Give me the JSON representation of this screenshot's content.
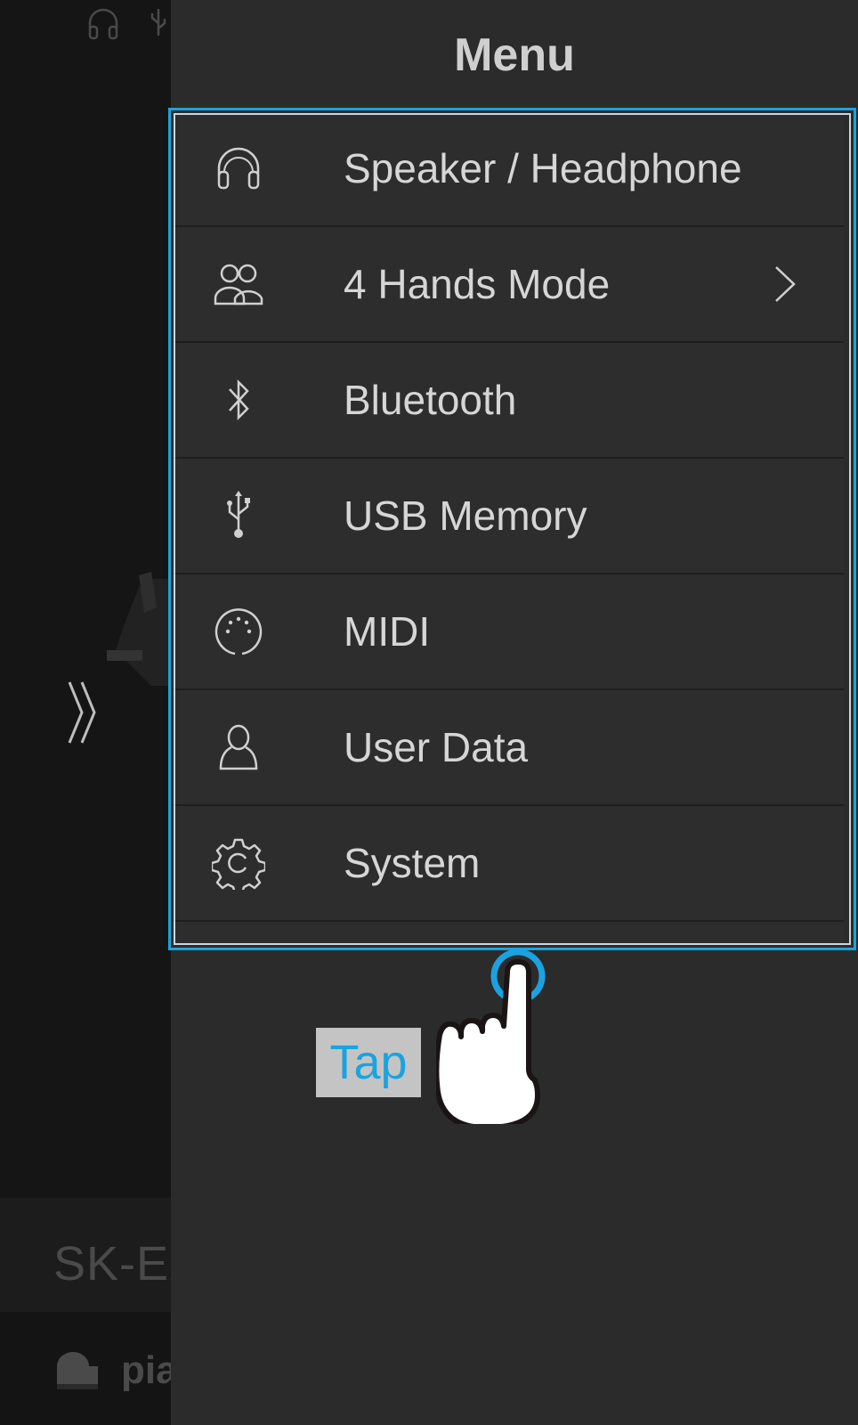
{
  "background": {
    "model_name": "SK-EX",
    "sound_label": "pia"
  },
  "menu": {
    "title": "Menu",
    "items": [
      {
        "label": "Speaker / Headphone",
        "icon": "headphone-icon",
        "has_submenu": false
      },
      {
        "label": "4 Hands Mode",
        "icon": "people-icon",
        "has_submenu": true
      },
      {
        "label": "Bluetooth",
        "icon": "bluetooth-icon",
        "has_submenu": false
      },
      {
        "label": "USB Memory",
        "icon": "usb-icon",
        "has_submenu": false
      },
      {
        "label": "MIDI",
        "icon": "midi-icon",
        "has_submenu": false
      },
      {
        "label": "User Data",
        "icon": "user-icon",
        "has_submenu": false
      },
      {
        "label": "System",
        "icon": "gear-icon",
        "has_submenu": false
      }
    ]
  },
  "hint": {
    "tap_label": "Tap",
    "accent_color": "#1aa3e0"
  }
}
